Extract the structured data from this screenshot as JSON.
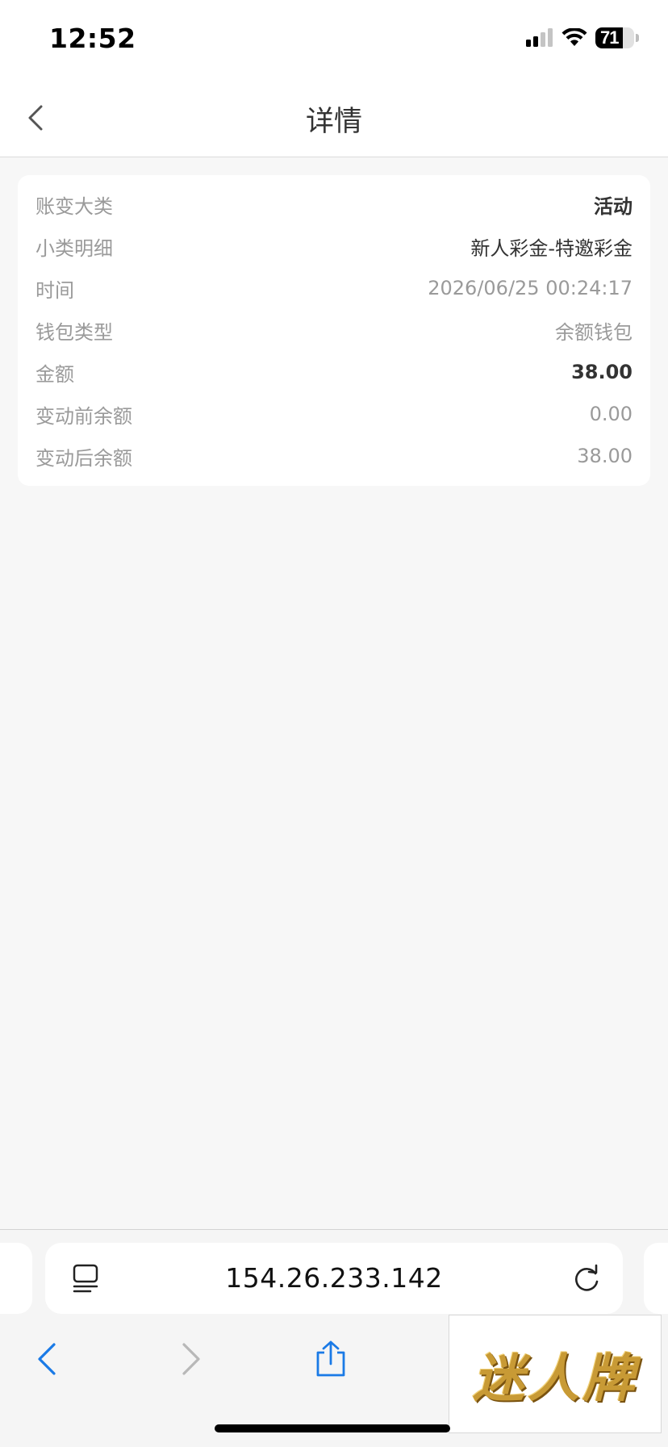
{
  "status_bar": {
    "time": "12:52",
    "battery": "71"
  },
  "nav": {
    "title": "详情"
  },
  "details": {
    "rows": [
      {
        "label": "账变大类",
        "value": "活动"
      },
      {
        "label": "小类明细",
        "value": "新人彩金-特邀彩金"
      },
      {
        "label": "时间",
        "value": "2026/06/25 00:24:17"
      },
      {
        "label": "钱包类型",
        "value": "余额钱包"
      },
      {
        "label": "金额",
        "value": "38.00"
      },
      {
        "label": "变动前余额",
        "value": "0.00"
      },
      {
        "label": "变动后余额",
        "value": "38.00"
      }
    ]
  },
  "browser": {
    "url": "154.26.233.142"
  },
  "watermark": {
    "text": "迷人牌"
  },
  "icons": {
    "back": "chevron-left-icon",
    "reader": "reader-mode-icon",
    "reload": "reload-icon",
    "nav_back": "arrow-back-icon",
    "nav_forward": "arrow-forward-icon",
    "share": "share-icon",
    "signal": "cellular-signal-icon",
    "wifi": "wifi-icon",
    "battery": "battery-icon"
  },
  "colors": {
    "accent": "#1a7ae6",
    "label_gray": "#9a9a9a",
    "text_dark": "#333333",
    "background": "#f7f7f7"
  }
}
